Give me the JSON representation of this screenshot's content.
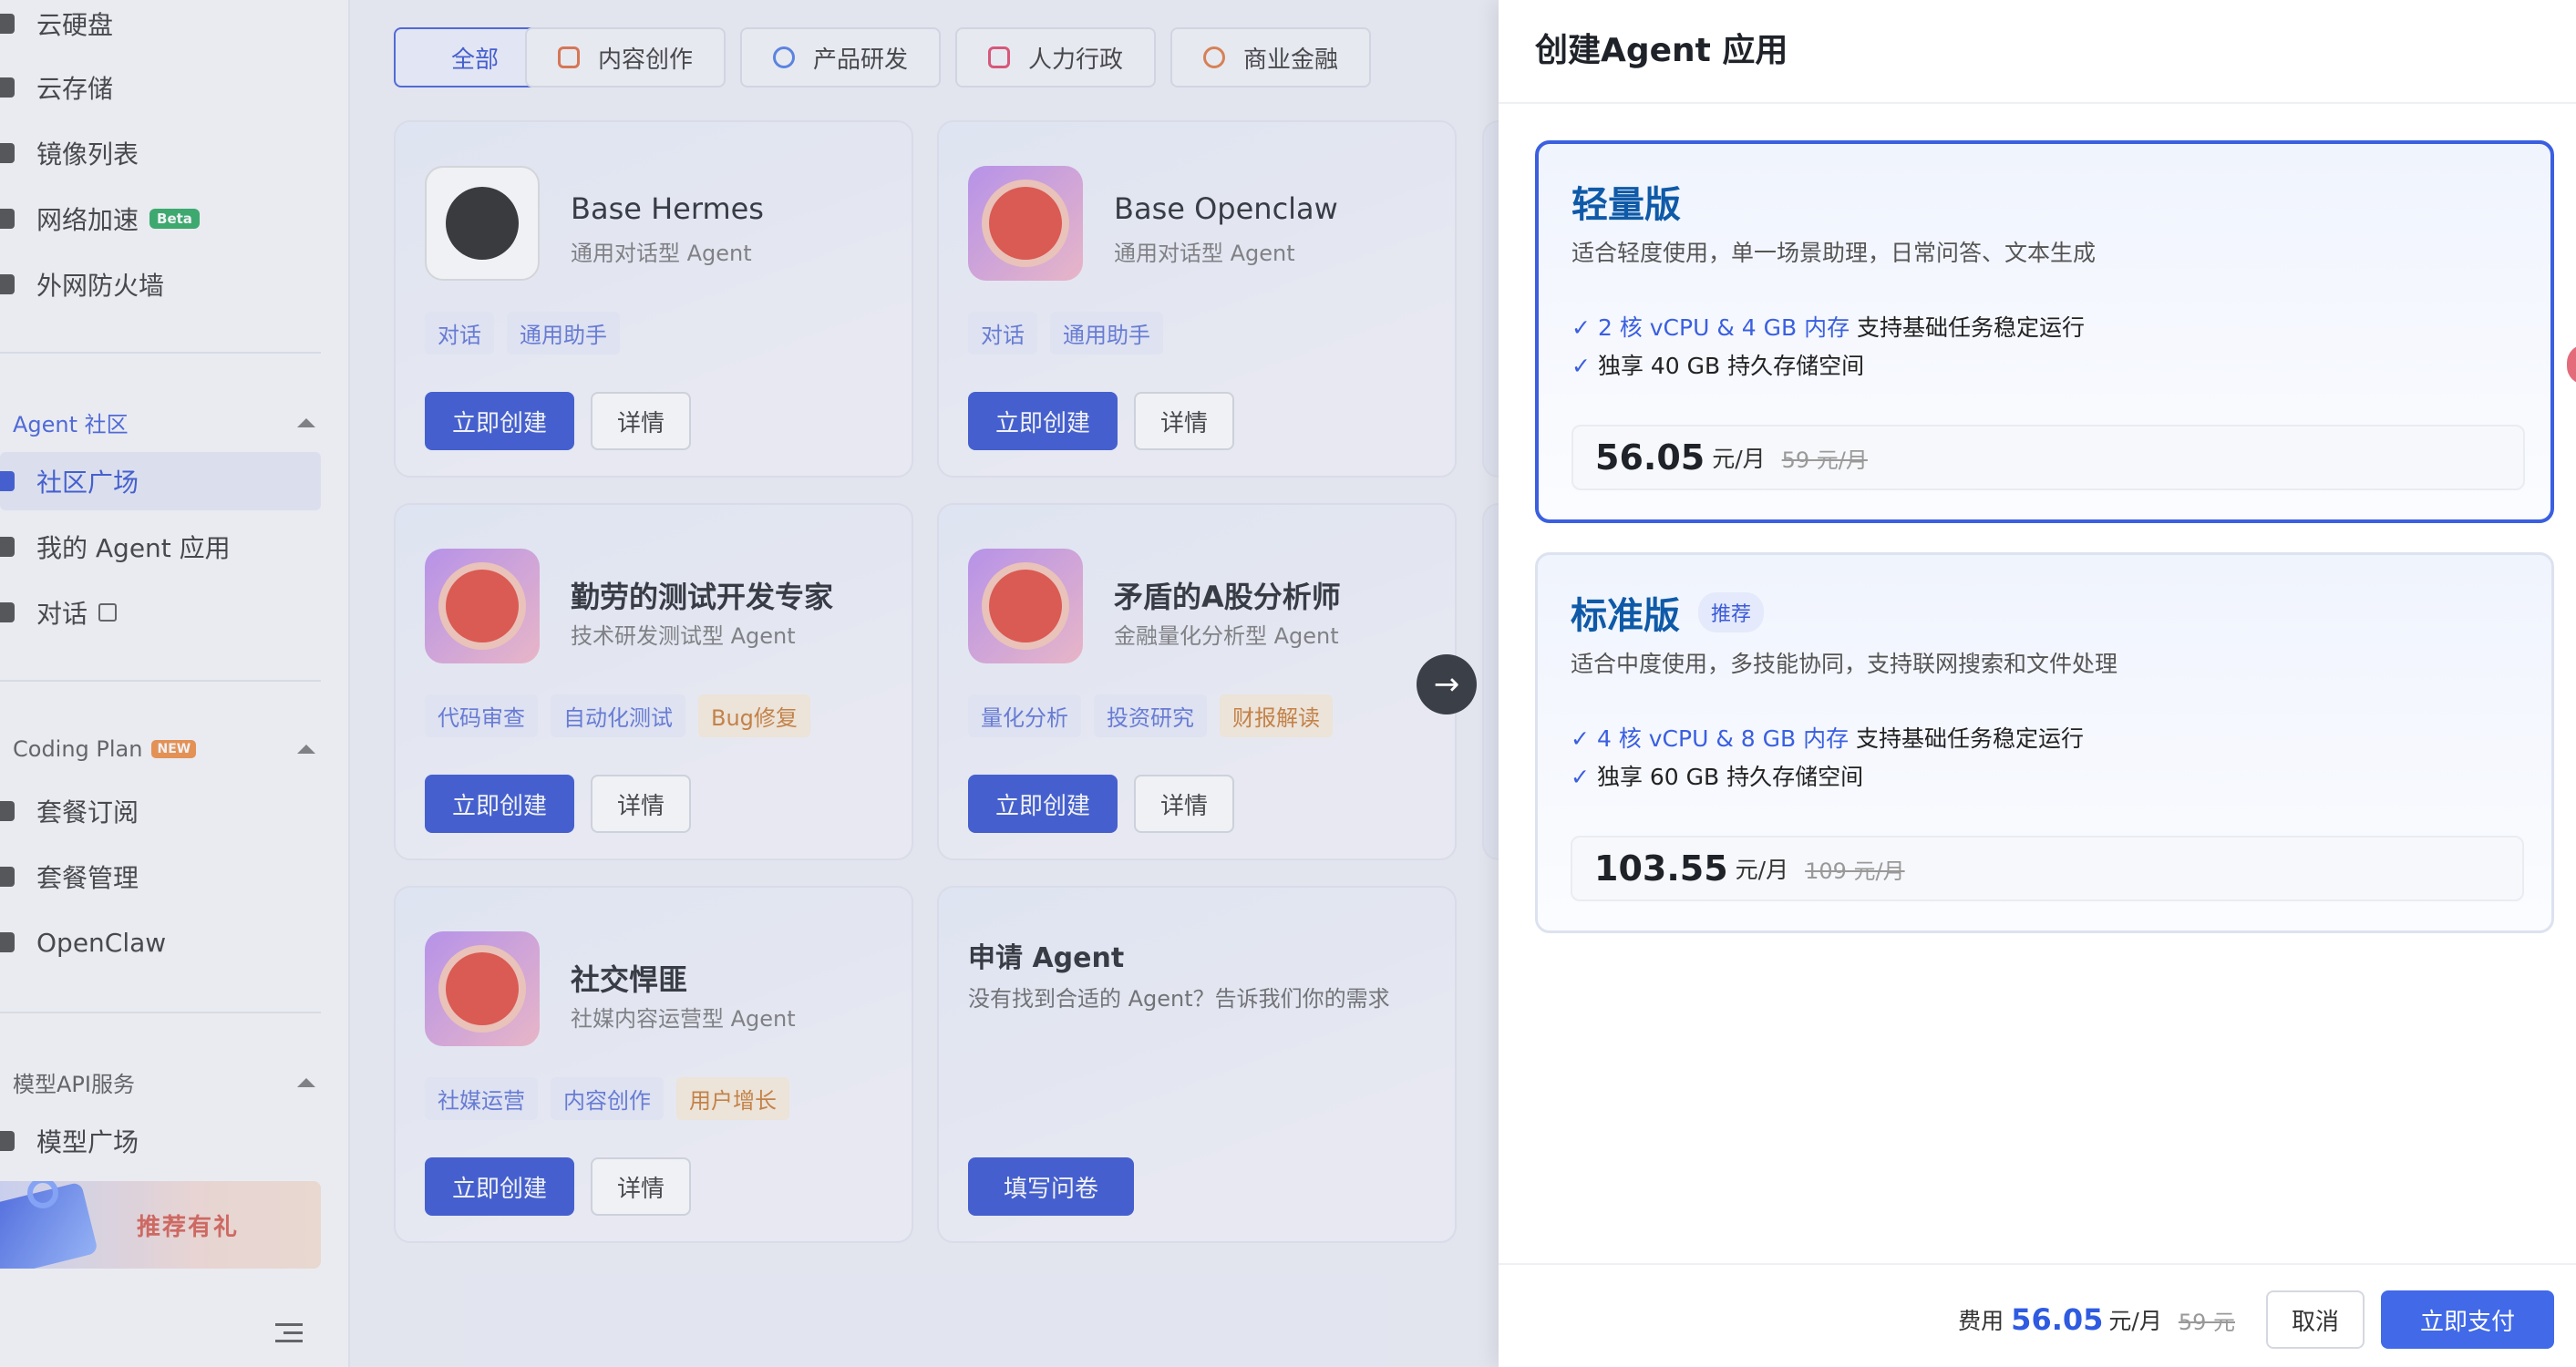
{
  "sidebar": {
    "items_top": [
      {
        "label": "云硬盘",
        "icon": "disk-icon"
      },
      {
        "label": "云存储",
        "icon": "storage-icon"
      },
      {
        "label": "镜像列表",
        "icon": "image-list-icon"
      },
      {
        "label": "网络加速",
        "icon": "network-icon",
        "badge": "Beta"
      },
      {
        "label": "外网防火墙",
        "icon": "firewall-icon"
      }
    ],
    "group_agent": {
      "title": "Agent 社区",
      "items": [
        {
          "label": "社区广场",
          "icon": "community-icon",
          "active": true
        },
        {
          "label": "我的 Agent 应用",
          "icon": "my-agent-icon"
        },
        {
          "label": "对话",
          "icon": "chat-icon"
        }
      ]
    },
    "group_coding": {
      "title": "Coding Plan",
      "badge": "NEW",
      "items": [
        {
          "label": "套餐订阅",
          "icon": "subscribe-icon"
        },
        {
          "label": "套餐管理",
          "icon": "plan-manage-icon"
        },
        {
          "label": "OpenClaw",
          "icon": "openclaw-icon"
        }
      ]
    },
    "group_model": {
      "title": "模型API服务",
      "items": [
        {
          "label": "模型广场",
          "icon": "model-square-icon"
        }
      ]
    },
    "promo": {
      "label": "推荐有礼"
    }
  },
  "filters": [
    "全部",
    "内容创作",
    "产品研发",
    "人力行政",
    "商业金融"
  ],
  "cards": [
    {
      "title": "Base Hermes",
      "sub": "通用对话型 Agent",
      "tags": [
        "对话",
        "通用助手"
      ],
      "primary": "立即创建",
      "secondary": "详情"
    },
    {
      "title": "Base Openclaw",
      "sub": "通用对话型 Agent",
      "tags": [
        "对话",
        "通用助手"
      ],
      "primary": "立即创建",
      "secondary": "详情"
    },
    {
      "title": "勤劳的测试开发专家",
      "sub": "技术研发测试型 Agent",
      "tags": [
        "代码审查",
        "自动化测试",
        "Bug修复"
      ],
      "primary": "立即创建",
      "secondary": "详情"
    },
    {
      "title": "矛盾的A股分析师",
      "sub": "金融量化分析型 Agent",
      "tags": [
        "量化分析",
        "投资研究",
        "财报解读"
      ],
      "primary": "立即创建",
      "secondary": "详情"
    },
    {
      "title": "社交悍匪",
      "sub": "社媒内容运营型 Agent",
      "tags": [
        "社媒运营",
        "内容创作",
        "用户增长"
      ],
      "primary": "立即创建",
      "secondary": "详情"
    }
  ],
  "apply_card": {
    "title": "申请 Agent",
    "desc": "没有找到合适的 Agent？告诉我们你的需求",
    "button": "填写问卷"
  },
  "drawer": {
    "title": "创建Agent 应用",
    "plans": [
      {
        "name": "轻量版",
        "badge": "",
        "desc": "适合轻度使用，单一场景助理，日常问答、文本生成",
        "feat1_hl": "2 核 vCPU & 4 GB 内存",
        "feat1_rest": " 支持基础任务稳定运行",
        "feat2": "独享 40 GB 持久存储空间",
        "price": "56.05",
        "unit": "元/月",
        "old": "59 元/月"
      },
      {
        "name": "标准版",
        "badge": "推荐",
        "desc": "适合中度使用，多技能协同，支持联网搜索和文件处理",
        "feat1_hl": "4 核 vCPU & 8 GB 内存",
        "feat1_rest": " 支持基础任务稳定运行",
        "feat2": "独享 60 GB 持久存储空间",
        "price": "103.55",
        "unit": "元/月",
        "old": "109 元/月"
      }
    ],
    "footer": {
      "label": "费用",
      "price": "56.05",
      "unit": "元/月",
      "old": "59 元",
      "cancel": "取消",
      "pay": "立即支付"
    }
  },
  "check_mark": "✓",
  "arrow": "→",
  "colors": {
    "primary": "#2f4fd0",
    "accent_blue": "#3a5fe0",
    "plan_name": "#0f5aa8",
    "pay_button": "#4169e8"
  }
}
